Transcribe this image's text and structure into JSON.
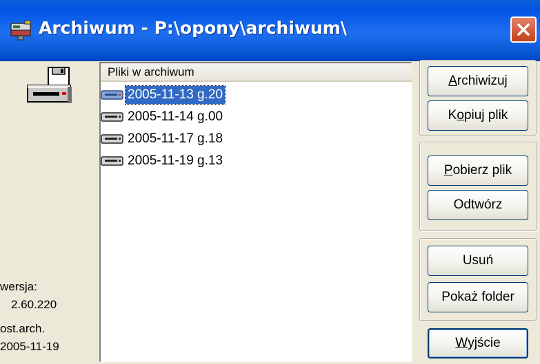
{
  "window": {
    "title": "Archiwum - P:\\opony\\archiwum\\",
    "icon": "app-icon",
    "close_icon": "close-icon"
  },
  "sidebar": {
    "icon": "floppy-drive-icon",
    "version_label": "wersja:",
    "version_value": "2.60.220",
    "last_archive_label": "ost.arch.",
    "last_archive_value": "2005-11-19"
  },
  "file_list": {
    "column_header": "Pliki w archiwum",
    "items": [
      {
        "label": "2005-11-13 g.20",
        "selected": true,
        "icon": "drive-icon"
      },
      {
        "label": "2005-11-14 g.00",
        "selected": false,
        "icon": "drive-icon"
      },
      {
        "label": "2005-11-17 g.18",
        "selected": false,
        "icon": "drive-icon"
      },
      {
        "label": "2005-11-19 g.13",
        "selected": false,
        "icon": "drive-icon"
      }
    ]
  },
  "buttons": {
    "archiwizuj": {
      "accel": "A",
      "rest": "rchiwizuj"
    },
    "kopiuj": {
      "pre": "K",
      "accel": "o",
      "rest": "piuj plik"
    },
    "pobierz": {
      "accel": "P",
      "rest": "obierz plik"
    },
    "odtworz": "Odtwórz",
    "usun": "Usuń",
    "pokaz": "Pokaż folder",
    "wyjscie": {
      "accel": "W",
      "rest": "yjście"
    }
  },
  "colors": {
    "titlebar": "#0054e3",
    "selection": "#316ac5",
    "face": "#ece9d8"
  }
}
